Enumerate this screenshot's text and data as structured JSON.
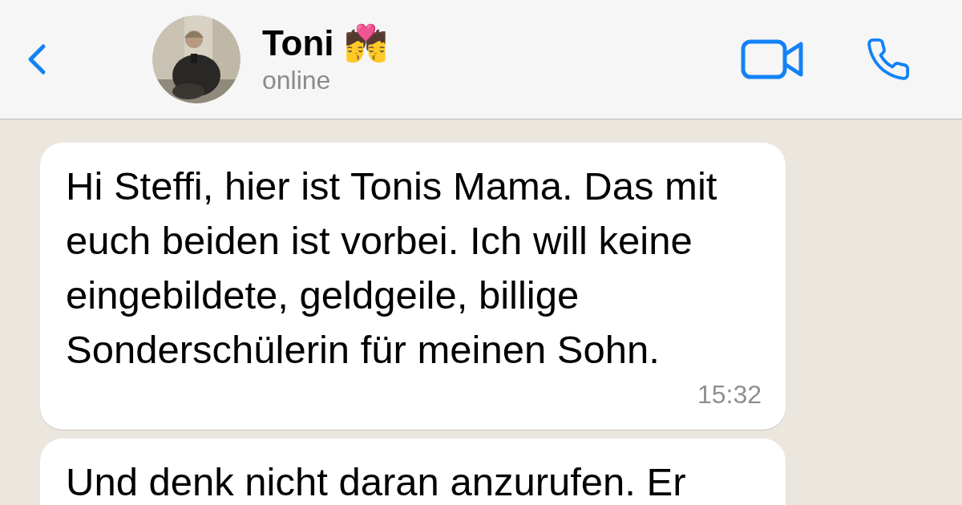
{
  "header": {
    "contact_name": "Toni",
    "name_emoji": "💏",
    "status": "online"
  },
  "messages": [
    {
      "text": "Hi Steffi, hier ist Tonis Mama. Das mit euch beiden ist vorbei. Ich will keine eingebildete, geldgeile, billige Sonderschülerin für meinen Sohn.",
      "time": "15:32"
    },
    {
      "text": "Und denk nicht daran anzurufen. Er"
    }
  ]
}
